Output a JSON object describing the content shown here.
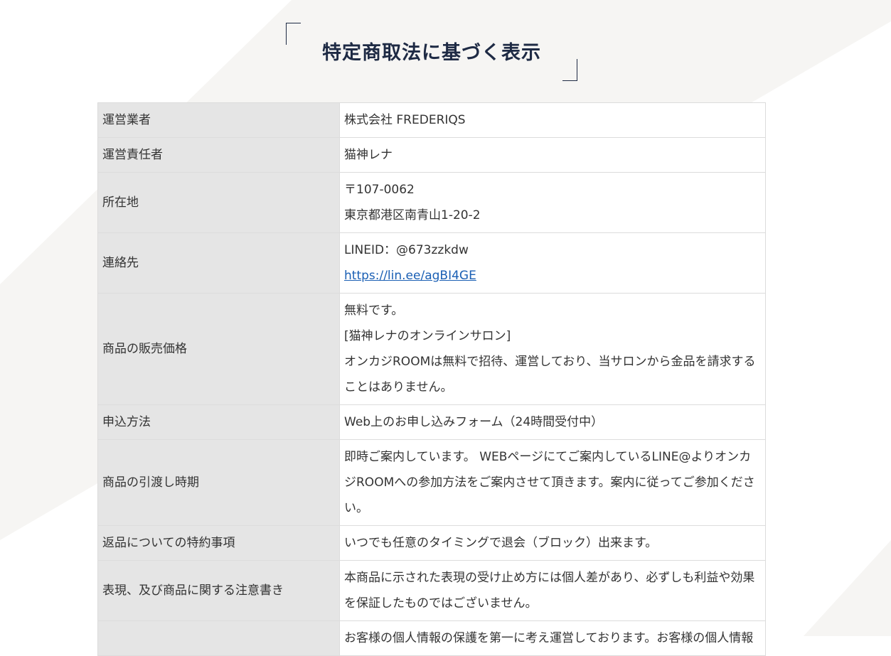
{
  "page": {
    "title": "特定商取法に基づく表示"
  },
  "table": {
    "rows": [
      {
        "label": "運営業者",
        "lines": [
          "株式会社 FREDERIQS"
        ]
      },
      {
        "label": "運営責任者",
        "lines": [
          "猫神レナ"
        ]
      },
      {
        "label": "所在地",
        "lines": [
          "〒107-0062",
          "東京都港区南青山1-20-2"
        ]
      },
      {
        "label": "連絡先",
        "lines": [
          "LINEID：@673zzkdw"
        ],
        "link": "https://lin.ee/agBI4GE"
      },
      {
        "label": "商品の販売価格",
        "lines": [
          "無料です。",
          "[猫神レナのオンラインサロン]",
          "オンカジROOMは無料で招待、運営しており、当サロンから金品を請求することはありません。"
        ]
      },
      {
        "label": "申込方法",
        "lines": [
          "Web上のお申し込みフォーム（24時間受付中）"
        ]
      },
      {
        "label": "商品の引渡し時期",
        "lines": [
          "即時ご案内しています。 WEBページにてご案内しているLINE@よりオンカジROOMへの参加方法をご案内させて頂きます。案内に従ってご参加ください。"
        ]
      },
      {
        "label": "返品についての特約事項",
        "lines": [
          "いつでも任意のタイミングで退会（ブロック）出来ます。"
        ]
      },
      {
        "label": "表現、及び商品に関する注意書き",
        "lines": [
          "本商品に示された表現の受け止め方には個人差があり、必ずしも利益や効果を保証したものではございません。"
        ]
      },
      {
        "label": "",
        "lines": [
          "お客様の個人情報の保護を第一に考え運営しております。お客様の個人情報"
        ]
      }
    ]
  },
  "colors": {
    "title": "#1e2a44",
    "header_bg": "#e5e5e5",
    "border": "#dcdcdc",
    "link": "#1a5fb4",
    "background_shape": "#f6f5f3"
  }
}
